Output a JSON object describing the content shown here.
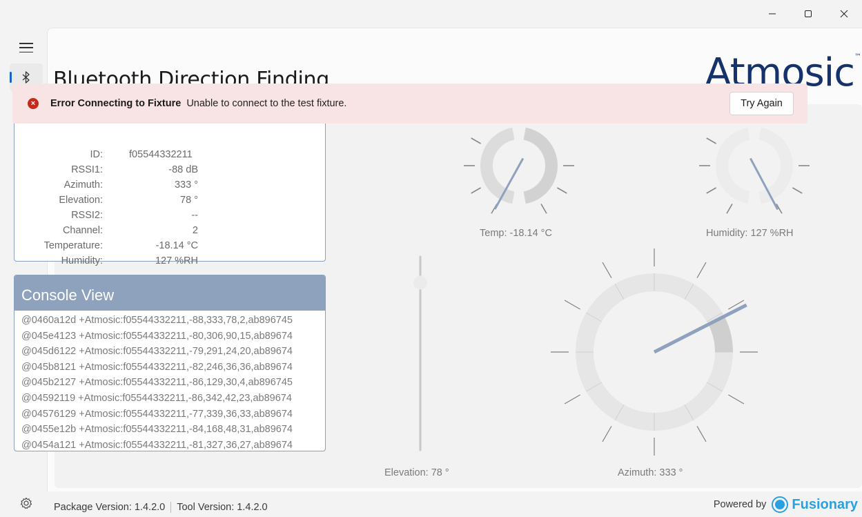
{
  "window": {
    "minimize_icon": "minimize-icon",
    "maximize_icon": "maximize-icon",
    "close_icon": "close-icon"
  },
  "nav": {
    "menu_icon": "hamburger-icon",
    "bluetooth_icon": "bluetooth-icon",
    "settings_icon": "gear-icon"
  },
  "header": {
    "title": "Bluetooth Direction Finding",
    "brand": "Atmosic",
    "brand_tm": "™"
  },
  "error": {
    "title": "Error Connecting to Fixture",
    "message": "Unable to connect to the test fixture.",
    "button": "Try Again",
    "color": "#c42b1c"
  },
  "info": [
    {
      "key": "ID:",
      "value": "f05544332211"
    },
    {
      "key": "RSSI1:",
      "value": "-88 dB"
    },
    {
      "key": "Azimuth:",
      "value": "333 °"
    },
    {
      "key": "Elevation:",
      "value": "78 °"
    },
    {
      "key": "RSSI2:",
      "value": "--"
    },
    {
      "key": "Channel:",
      "value": "2"
    },
    {
      "key": "Temperature:",
      "value": "-18.14 °C"
    },
    {
      "key": "Humidity:",
      "value": "127 %RH"
    }
  ],
  "console": {
    "title": "Console View",
    "lines": [
      "@0460a12d +Atmosic:f05544332211,-88,333,78,2,ab896745",
      "@045e4123 +Atmosic:f05544332211,-80,306,90,15,ab89674",
      "@045d6122 +Atmosic:f05544332211,-79,291,24,20,ab89674",
      "@045b8121 +Atmosic:f05544332211,-82,246,36,36,ab89674",
      "@045b2127 +Atmosic:f05544332211,-86,129,30,4,ab896745",
      "@04592119 +Atmosic:f05544332211,-86,342,42,23,ab89674",
      "@04576129 +Atmosic:f05544332211,-77,339,36,33,ab89674",
      "@0455e12b +Atmosic:f05544332211,-84,168,48,31,ab89674",
      "@0454a121 +Atmosic:f05544332211,-81,327,36,27,ab89674"
    ]
  },
  "gauges": {
    "temp_label": "Temp: -18.14 °C",
    "humidity_label": "Humidity: 127 %RH",
    "elevation_label": "Elevation: 78 °",
    "azimuth_label": "Azimuth: 333 °",
    "elevation_value": 78,
    "azimuth_value": 333,
    "needle_color": "#8fa2bd"
  },
  "footer": {
    "package_version": "Package Version: 1.4.2.0",
    "tool_version": "Tool Version: 1.4.2.0",
    "powered_by": "Powered by",
    "fusionary": "Fusionary"
  }
}
